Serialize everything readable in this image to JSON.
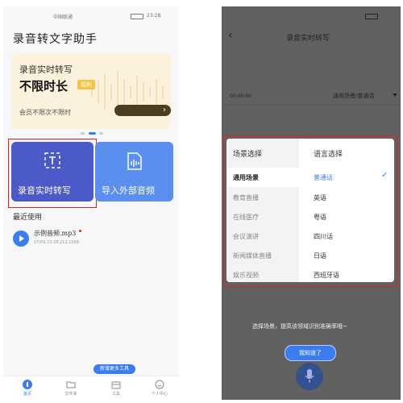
{
  "left_screen": {
    "status_bar": {
      "left": "中国联通",
      "right": "23:28"
    },
    "app_title": "录音转文字助手",
    "banner": {
      "line1": "录音实时转写",
      "line2": "不限时长",
      "badge": "福利",
      "line3": "会员不限次不限时"
    },
    "tiles": [
      {
        "label": "录音实时转写",
        "icon": "frame-t-icon",
        "color": "#4c59c8"
      },
      {
        "label": "导入外部音频",
        "icon": "audio-file-icon",
        "color": "#5a8ff0"
      }
    ],
    "recent_title": "最近使用",
    "recent_item": {
      "name": "示例音频.mp3",
      "meta": "07/09 23:28  212.15KB"
    },
    "more_tools_button": "新增更多工具",
    "tabs": [
      {
        "label": "首页",
        "icon": "home-icon",
        "active": true
      },
      {
        "label": "文件夹",
        "icon": "folder-icon",
        "active": false
      },
      {
        "label": "工具",
        "icon": "toolbox-icon",
        "active": false
      },
      {
        "label": "个人中心",
        "icon": "smiley-icon",
        "active": false
      }
    ],
    "accent_color": "#3a7cf2"
  },
  "right_screen": {
    "nav_title": "录音实时转写",
    "time_display": "00:00:00",
    "mode_display": "通用场景/普通话",
    "picker": {
      "scene_header": "场景选择",
      "language_header": "语言选择",
      "scenes": [
        "通用场景",
        "教育直播",
        "在线医疗",
        "会议演讲",
        "新闻媒体直播",
        "娱乐视频"
      ],
      "selected_scene": "通用场景",
      "languages": [
        "普通话",
        "英语",
        "粤语",
        "四川话",
        "日语",
        "西班牙语"
      ],
      "selected_language": "普通话"
    },
    "hint": "选择场景，提高该领域识别准确率哦~",
    "ok_button": "我知道了"
  }
}
